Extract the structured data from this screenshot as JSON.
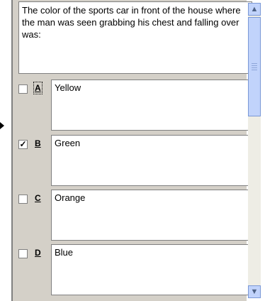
{
  "question": {
    "text": "The color of the sports car in front of the house where the man was seen grabbing his chest and falling over was:"
  },
  "options": [
    {
      "letter": "A",
      "text": "Yellow",
      "checked": false
    },
    {
      "letter": "B",
      "text": "Green",
      "checked": true
    },
    {
      "letter": "C",
      "text": "Orange",
      "checked": false
    },
    {
      "letter": "D",
      "text": "Blue",
      "checked": false
    }
  ],
  "icons": {
    "pointer": "right-arrow-icon",
    "scroll_up": "scroll-up-icon",
    "scroll_down": "scroll-down-icon",
    "check": "checkmark-icon"
  },
  "colors": {
    "panel_bg": "#d4d0c8",
    "scrollbar_accent": "#c1d3fb"
  }
}
